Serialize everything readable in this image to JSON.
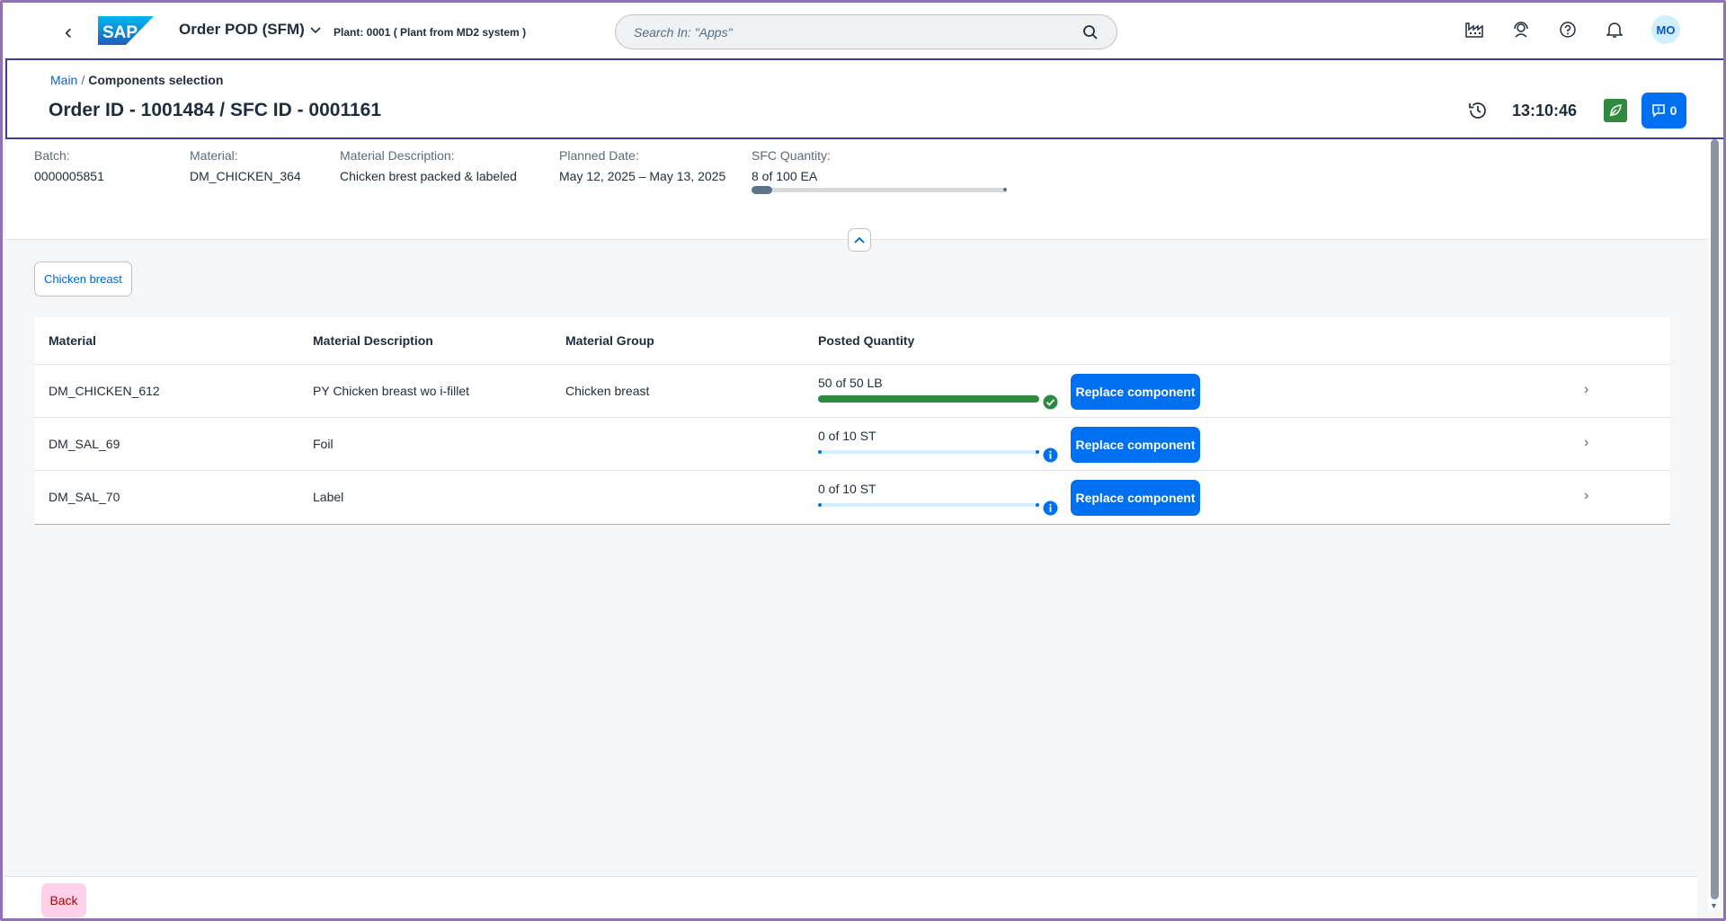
{
  "shell": {
    "back_label": "‹",
    "logo_text": "SAP",
    "app_title": "Order POD (SFM)",
    "plant": "Plant: 0001 ( Plant from MD2 system )",
    "search_placeholder": "Search In: \"Apps\"",
    "avatar": "MO"
  },
  "header": {
    "breadcrumb_link": "Main",
    "breadcrumb_sep": "/",
    "breadcrumb_current": "Components selection",
    "title": "Order ID - 1001484 / SFC ID - 0001161",
    "clock": "13:10:46",
    "notification_count": "0"
  },
  "attributes": {
    "batch_label": "Batch:",
    "batch_value": "0000005851",
    "material_label": "Material:",
    "material_value": "DM_CHICKEN_364",
    "description_label": "Material Description:",
    "description_value": "Chicken brest packed & labeled",
    "planned_label": "Planned Date:",
    "planned_value": "May 12, 2025 – May 13, 2025",
    "sfc_label": "SFC Quantity:",
    "sfc_value": "8 of 100 EA",
    "sfc_progress": 0.08
  },
  "filter_chip": "Chicken breast",
  "table": {
    "headers": [
      "Material",
      "Material Description",
      "Material Group",
      "Posted Quantity"
    ],
    "rows": [
      {
        "material": "DM_CHICKEN_612",
        "description": "PY Chicken breast wo i-fillet",
        "group": "Chicken breast",
        "qty": "50 of 50 LB",
        "progress": 1.0,
        "status": "complete",
        "button": "Replace component"
      },
      {
        "material": "DM_SAL_69",
        "description": "Foil",
        "group": "",
        "qty": "0 of 10 ST",
        "progress": 0.0,
        "status": "info",
        "button": "Replace component"
      },
      {
        "material": "DM_SAL_70",
        "description": "Label",
        "group": "",
        "qty": "0 of 10 ST",
        "progress": 0.0,
        "status": "info",
        "button": "Replace component"
      }
    ]
  },
  "footer": {
    "back_label": "Back"
  },
  "colors": {
    "brand_blue": "#0070f2",
    "success_green": "#2e8a3f",
    "info_blue": "#0070f2",
    "header_border": "#3b3e9a"
  },
  "icons": [
    "chevron-left-icon",
    "chevron-down-icon",
    "search-icon",
    "factory-icon",
    "user-support-icon",
    "help-icon",
    "bell-icon",
    "history-icon",
    "leaf-icon",
    "message-icon",
    "collapse-up-icon",
    "success-check-icon",
    "info-icon",
    "row-chevron-icon"
  ]
}
